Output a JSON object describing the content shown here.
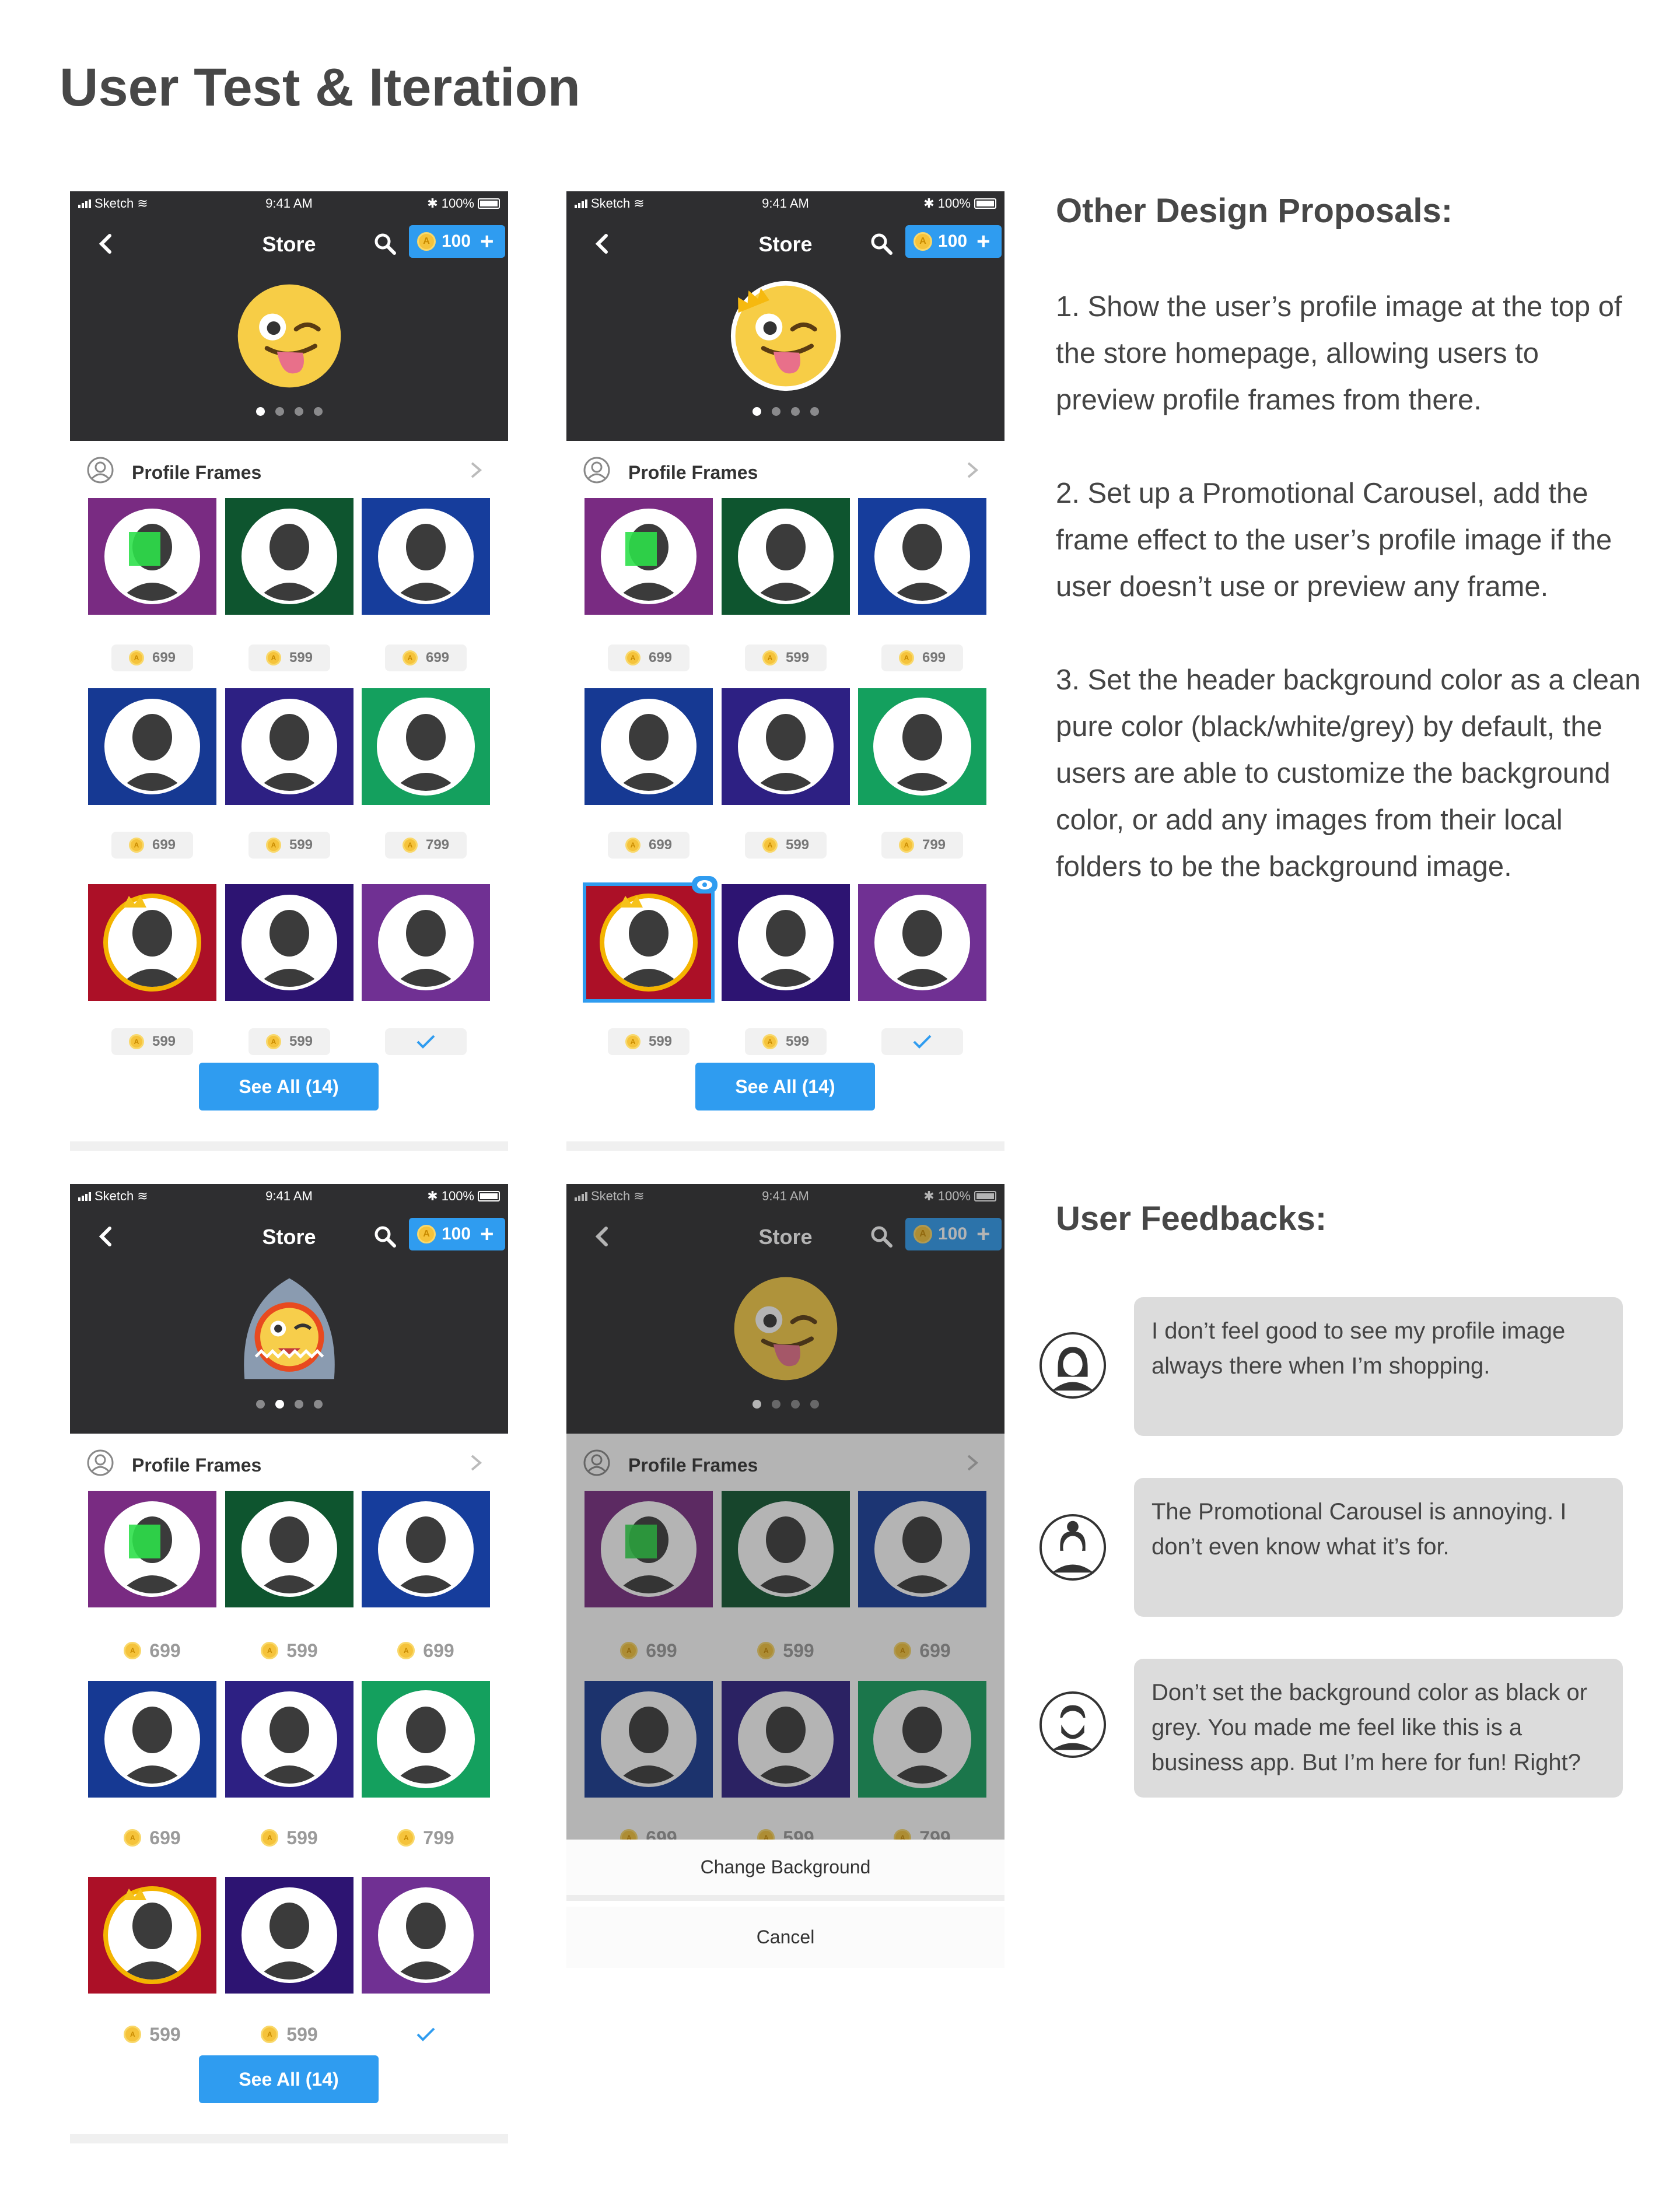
{
  "page_title": "User Test & Iteration",
  "status_bar": {
    "carrier": "Sketch",
    "time": "9:41 AM",
    "battery": "100%"
  },
  "store_header": {
    "title": "Store",
    "coins": "100"
  },
  "section": {
    "label": "Profile Frames"
  },
  "see_all_label": "See All (14)",
  "prices": [
    "699",
    "599",
    "699",
    "699",
    "599",
    "799",
    "599",
    "599"
  ],
  "action_sheet": {
    "change_background": "Change Background",
    "cancel": "Cancel"
  },
  "proposals": {
    "title": "Other Design Proposals:",
    "items": [
      "1. Show the user’s profile image at the top of the store homepage, allowing users to preview profile frames from there.",
      "2. Set up a Promotional Carousel, add the frame effect to the user’s profile image if the user doesn’t use or preview any frame.",
      "3. Set the header background color as a clean pure color (black/white/grey) by default, the users are able to customize the background color, or add any images from their local folders to be the background image."
    ]
  },
  "feedback": {
    "title": "User Feedbacks:",
    "items": [
      "I don’t feel good to see my profile image always there when I’m shopping.",
      "The Promotional Carousel is annoying. I don’t even know what it’s for.",
      "Don’t set the background color as black or grey. You made me feel like this is a business app. But I’m here for fun! Right?"
    ]
  },
  "colors": {
    "accent": "#2f9cf0",
    "header_bg": "#2e2e30",
    "coin": "#f5c33b",
    "bubble": "#dcdcdc"
  }
}
